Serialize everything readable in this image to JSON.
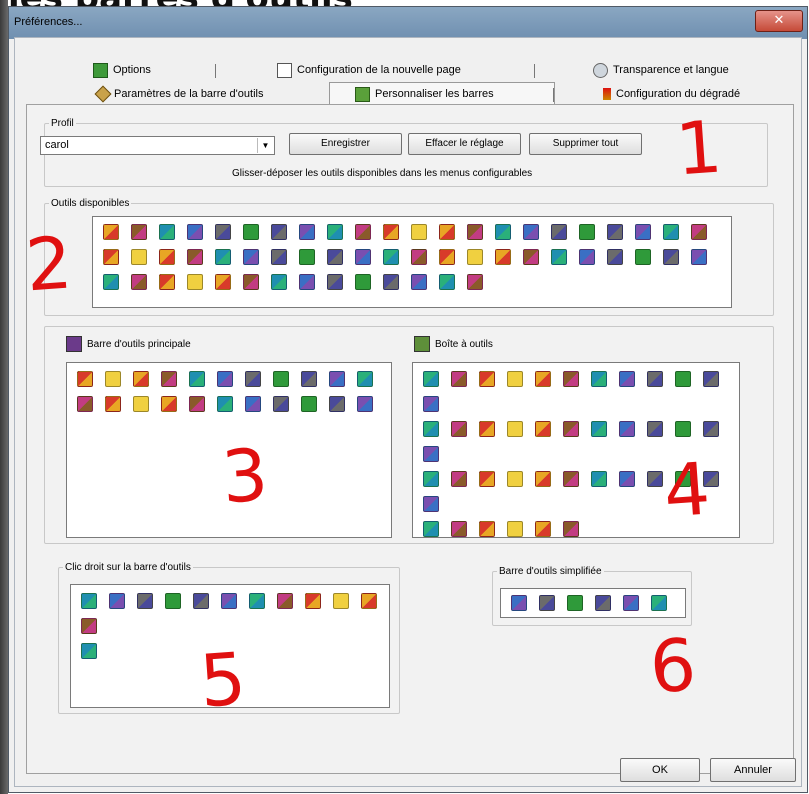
{
  "page": {
    "heading": "les barres d'outils"
  },
  "window": {
    "title": "Préférences...",
    "close_glyph": "✕"
  },
  "tabs": {
    "row1": [
      {
        "label": "Options",
        "icon": "options-icon"
      },
      {
        "label": "Configuration de la nouvelle page",
        "icon": "page-icon"
      },
      {
        "label": "Transparence et langue",
        "icon": "transparency-icon"
      }
    ],
    "row2": [
      {
        "label": "Paramètres de la barre d'outils",
        "icon": "wrench-icon"
      },
      {
        "label": "Personnaliser les barres",
        "icon": "customize-icon"
      },
      {
        "label": "Configuration du dégradé",
        "icon": "gradient-icon"
      }
    ],
    "active": "Personnaliser les barres"
  },
  "profile": {
    "legend": "Profil",
    "value": "carol",
    "buttons": {
      "save": "Enregistrer",
      "reset": "Effacer le réglage",
      "delete_all": "Supprimer tout"
    },
    "hint": "Glisser-déposer les outils disponibles dans les menus configurables"
  },
  "available_tools": {
    "legend": "Outils disponibles",
    "rows": [
      22,
      22,
      14
    ]
  },
  "main_toolbar": {
    "label": "Barre d'outils principale",
    "rows": [
      11,
      11
    ]
  },
  "toolbox": {
    "label": "Boîte à outils",
    "rows": [
      12,
      12,
      12,
      6
    ]
  },
  "right_click": {
    "legend": "Clic droit sur la barre d'outils",
    "rows": [
      12,
      1
    ]
  },
  "simple_toolbar": {
    "legend": "Barre d'outils simplifiée",
    "rows": [
      6
    ]
  },
  "footer": {
    "ok": "OK",
    "cancel": "Annuler"
  },
  "annotations": [
    "1",
    "2",
    "3",
    "4",
    "5",
    "6"
  ],
  "colors": {
    "annotation_red": "#e01010",
    "titlebar": "#7b98b6",
    "tool_palette": [
      "#3a6fc4",
      "#d83a2a",
      "#2f9a3a",
      "#e8a624",
      "#7a4fb0",
      "#1f8fb0",
      "#c23c82",
      "#6b6b6b",
      "#f0d040",
      "#4a4a9a",
      "#8a5a2a",
      "#2ab07a"
    ]
  }
}
